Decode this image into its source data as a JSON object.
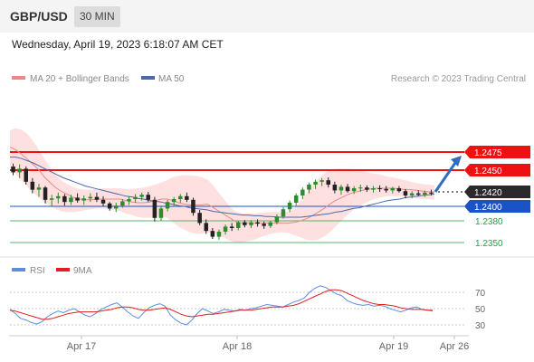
{
  "header": {
    "pair": "GBP/USD",
    "timeframe": "30 MIN"
  },
  "timestamp": "Wednesday, April 19, 2023 6:18:07 AM CET",
  "legend": {
    "ma20": "MA 20 + Bollinger Bands",
    "ma50": "MA 50",
    "credit": "Research © 2023 Trading Central",
    "rsi": "RSI",
    "rsi_ma": "9MA"
  },
  "colors": {
    "resistance": "#ee1111",
    "support": "#1a52c8",
    "target": "#22a33a",
    "bollinger": "#ffd6d6",
    "ma20": "#ee8888",
    "ma50": "#4a6aa8",
    "candle_up": "#2e8b2e",
    "candle_down": "#222222",
    "rsi_line": "#5b8de0",
    "rsi_ma_line": "#e02020",
    "forecast_arrow": "#2f6dc0"
  },
  "chart_data": [
    {
      "type": "line",
      "title": "GBP/USD 30 MIN",
      "x_labels": [
        "Apr 17",
        "Apr 18",
        "Apr 19",
        "Apr 26"
      ],
      "ylim": [
        1.234,
        1.251
      ],
      "y_range_from_lines": true,
      "current_price": 1.242,
      "levels": [
        {
          "label": "1.2475",
          "value": 1.2475,
          "kind": "resistance",
          "style": "thick-line"
        },
        {
          "label": "1.2450",
          "value": 1.245,
          "kind": "resistance",
          "style": "thick-line"
        },
        {
          "label": "1.2420",
          "value": 1.242,
          "kind": "current",
          "style": "dotted"
        },
        {
          "label": "1.2400",
          "value": 1.24,
          "kind": "support",
          "style": "thin-line"
        },
        {
          "label": "1.2380",
          "value": 1.238,
          "kind": "target",
          "style": "thin-line"
        },
        {
          "label": "1.2350",
          "value": 1.235,
          "kind": "target",
          "style": "thin-line"
        }
      ],
      "series": [
        {
          "name": "Price",
          "values": [
            1.2455,
            1.245,
            1.2452,
            1.244,
            1.243,
            1.2432,
            1.2425,
            1.2415,
            1.2408,
            1.241,
            1.2412,
            1.2405,
            1.2408,
            1.241,
            1.2412,
            1.2412,
            1.2413,
            1.2412,
            1.2408,
            1.2405,
            1.2402,
            1.2405,
            1.2408,
            1.241,
            1.2415,
            1.2418,
            1.2415,
            1.2408,
            1.2385,
            1.2398,
            1.2405,
            1.241,
            1.2414,
            1.2418,
            1.2413,
            1.2395,
            1.238,
            1.2368,
            1.2362,
            1.2358,
            1.2368,
            1.2374,
            1.2372,
            1.2378,
            1.2376,
            1.2377,
            1.2378,
            1.2376,
            1.2373,
            1.2376,
            1.2385,
            1.2395,
            1.2405,
            1.2415,
            1.2422,
            1.2428,
            1.2432,
            1.2435,
            1.2432,
            1.2428,
            1.2428,
            1.2422,
            1.242,
            1.2422,
            1.2425,
            1.2424,
            1.2423,
            1.2422,
            1.2423,
            1.2424,
            1.2421,
            1.2415,
            1.2418,
            1.2418
          ]
        },
        {
          "name": "MA 20",
          "values": [
            1.2482,
            1.2478,
            1.2472,
            1.2465,
            1.2458,
            1.245,
            1.244,
            1.2432,
            1.2425,
            1.242,
            1.2416,
            1.2412,
            1.241,
            1.2409,
            1.2409,
            1.241,
            1.241,
            1.241,
            1.241,
            1.241,
            1.2408,
            1.2406,
            1.2405,
            1.2405,
            1.2406,
            1.2408,
            1.241,
            1.241,
            1.2408,
            1.2405,
            1.2403,
            1.2402,
            1.2402,
            1.2402,
            1.2403,
            1.2398,
            1.2393,
            1.2388,
            1.2383,
            1.2378,
            1.2377,
            1.2377,
            1.2377,
            1.2377,
            1.2377,
            1.2377,
            1.2377,
            1.2377,
            1.2377,
            1.2378,
            1.238,
            1.2383,
            1.2387,
            1.2392,
            1.2397,
            1.2403,
            1.2408,
            1.2412,
            1.2416,
            1.2419,
            1.2421,
            1.2423,
            1.2424,
            1.2425,
            1.2425,
            1.2425,
            1.2425,
            1.2424,
            1.2423,
            1.2423,
            1.2422,
            1.2421,
            1.242,
            1.242
          ]
        },
        {
          "name": "MA 50",
          "values": [
            1.2468,
            1.2468,
            1.2466,
            1.2463,
            1.246,
            1.2456,
            1.2452,
            1.2448,
            1.2444,
            1.244,
            1.2437,
            1.2434,
            1.2431,
            1.2428,
            1.2426,
            1.2424,
            1.2422,
            1.242,
            1.2418,
            1.2416,
            1.2414,
            1.2413,
            1.2411,
            1.241,
            1.2408,
            1.2407,
            1.2406,
            1.2404,
            1.2403,
            1.2401,
            1.24,
            1.2398,
            1.2397,
            1.2396,
            1.2395,
            1.2393,
            1.2392,
            1.2391,
            1.239,
            1.2389,
            1.2388,
            1.2388,
            1.2387,
            1.2387,
            1.2386,
            1.2386,
            1.2385,
            1.2385,
            1.2385,
            1.2385,
            1.2385,
            1.2386,
            1.2387,
            1.2388,
            1.2389,
            1.239,
            1.2392,
            1.2393,
            1.2395,
            1.2397,
            1.2398,
            1.24,
            1.2402,
            1.2404,
            1.2406,
            1.2408,
            1.2409,
            1.241,
            1.2412,
            1.2413,
            1.2414,
            1.2415,
            1.2416,
            1.2417
          ]
        },
        {
          "name": "Bollinger Upper",
          "values": [
            1.2505,
            1.2508,
            1.2506,
            1.25,
            1.249,
            1.2478,
            1.2465,
            1.2452,
            1.2442,
            1.2435,
            1.243,
            1.2426,
            1.2424,
            1.2423,
            1.2423,
            1.2424,
            1.2425,
            1.2425,
            1.2425,
            1.2425,
            1.2424,
            1.2424,
            1.2425,
            1.2426,
            1.2428,
            1.243,
            1.2433,
            1.2436,
            1.244,
            1.2442,
            1.2443,
            1.2443,
            1.2442,
            1.244,
            1.2437,
            1.2428,
            1.2418,
            1.2408,
            1.2398,
            1.2392,
            1.239,
            1.239,
            1.239,
            1.2391,
            1.2392,
            1.2392,
            1.2392,
            1.2392,
            1.2393,
            1.2398,
            1.2408,
            1.2418,
            1.2428,
            1.2438,
            1.2445,
            1.245,
            1.2452,
            1.2452,
            1.2452,
            1.2451,
            1.245,
            1.2448,
            1.2446,
            1.2445,
            1.2443,
            1.2441,
            1.244,
            1.2438,
            1.2436,
            1.2434,
            1.2432,
            1.2431,
            1.243,
            1.2429
          ]
        },
        {
          "name": "Bollinger Lower",
          "values": [
            1.2452,
            1.2445,
            1.2436,
            1.2427,
            1.2419,
            1.2412,
            1.2405,
            1.24,
            1.2396,
            1.2393,
            1.2392,
            1.2392,
            1.2393,
            1.2395,
            1.2396,
            1.2397,
            1.2397,
            1.2396,
            1.2395,
            1.2393,
            1.239,
            1.2388,
            1.2385,
            1.2384,
            1.2384,
            1.2385,
            1.2386,
            1.2384,
            1.2378,
            1.2372,
            1.2368,
            1.2364,
            1.2362,
            1.2362,
            1.2364,
            1.2363,
            1.236,
            1.2356,
            1.2352,
            1.235,
            1.235,
            1.2352,
            1.2354,
            1.2357,
            1.236,
            1.2362,
            1.2364,
            1.2364,
            1.2363,
            1.236,
            1.2357,
            1.2354,
            1.2353,
            1.2354,
            1.2358,
            1.2364,
            1.2372,
            1.238,
            1.2388,
            1.2395,
            1.24,
            1.2404,
            1.2408,
            1.2411,
            1.2413,
            1.2414,
            1.2414,
            1.2414,
            1.2413,
            1.2412,
            1.2411,
            1.241,
            1.241,
            1.2409
          ]
        }
      ],
      "candles": [
        [
          1.2455,
          1.2459,
          1.2443,
          1.2447
        ],
        [
          1.2447,
          1.2458,
          1.2439,
          1.2452
        ],
        [
          1.2452,
          1.2455,
          1.243,
          1.2434
        ],
        [
          1.2434,
          1.2439,
          1.2418,
          1.2423
        ],
        [
          1.2423,
          1.2431,
          1.2413,
          1.2426
        ],
        [
          1.2426,
          1.2428,
          1.2404,
          1.2409
        ],
        [
          1.2409,
          1.2416,
          1.24,
          1.2411
        ],
        [
          1.2411,
          1.2419,
          1.2404,
          1.2414
        ],
        [
          1.2414,
          1.2417,
          1.2401,
          1.2406
        ],
        [
          1.2406,
          1.2416,
          1.2402,
          1.2412
        ],
        [
          1.2412,
          1.2418,
          1.2405,
          1.2408
        ],
        [
          1.2408,
          1.2415,
          1.2402,
          1.2411
        ],
        [
          1.2411,
          1.2418,
          1.2406,
          1.2413
        ],
        [
          1.2413,
          1.2419,
          1.2406,
          1.2409
        ],
        [
          1.2409,
          1.2414,
          1.24,
          1.2404
        ],
        [
          1.2404,
          1.2406,
          1.2394,
          1.2397
        ],
        [
          1.2397,
          1.2405,
          1.2392,
          1.2401
        ],
        [
          1.2401,
          1.241,
          1.2398,
          1.2407
        ],
        [
          1.2407,
          1.2414,
          1.2402,
          1.241
        ],
        [
          1.241,
          1.2417,
          1.2405,
          1.2413
        ],
        [
          1.2413,
          1.2419,
          1.2408,
          1.2416
        ],
        [
          1.2416,
          1.242,
          1.2406,
          1.2409
        ],
        [
          1.2409,
          1.2413,
          1.2379,
          1.2384
        ],
        [
          1.2384,
          1.2401,
          1.238,
          1.2397
        ],
        [
          1.2397,
          1.2409,
          1.2393,
          1.2406
        ],
        [
          1.2406,
          1.2413,
          1.2401,
          1.241
        ],
        [
          1.241,
          1.2417,
          1.2405,
          1.2414
        ],
        [
          1.2414,
          1.2419,
          1.2406,
          1.2409
        ],
        [
          1.2409,
          1.2412,
          1.2387,
          1.2391
        ],
        [
          1.2391,
          1.2395,
          1.2374,
          1.2377
        ],
        [
          1.2377,
          1.2382,
          1.2362,
          1.2366
        ],
        [
          1.2366,
          1.237,
          1.2355,
          1.2358
        ],
        [
          1.2358,
          1.2368,
          1.2354,
          1.2365
        ],
        [
          1.2365,
          1.2375,
          1.2361,
          1.2372
        ],
        [
          1.2372,
          1.2377,
          1.2366,
          1.237
        ],
        [
          1.237,
          1.238,
          1.2367,
          1.2378
        ],
        [
          1.2378,
          1.2381,
          1.2371,
          1.2374
        ],
        [
          1.2374,
          1.2381,
          1.237,
          1.2378
        ],
        [
          1.2378,
          1.2382,
          1.2372,
          1.2376
        ],
        [
          1.2376,
          1.2379,
          1.2369,
          1.2373
        ],
        [
          1.2373,
          1.238,
          1.237,
          1.2378
        ],
        [
          1.2378,
          1.2389,
          1.2375,
          1.2386
        ],
        [
          1.2386,
          1.2399,
          1.2383,
          1.2396
        ],
        [
          1.2396,
          1.2408,
          1.2392,
          1.2405
        ],
        [
          1.2405,
          1.2418,
          1.2401,
          1.2415
        ],
        [
          1.2415,
          1.2426,
          1.241,
          1.2423
        ],
        [
          1.2423,
          1.2433,
          1.2418,
          1.243
        ],
        [
          1.243,
          1.2437,
          1.2424,
          1.2434
        ],
        [
          1.2434,
          1.2439,
          1.2428,
          1.2436
        ],
        [
          1.2436,
          1.244,
          1.2426,
          1.243
        ],
        [
          1.243,
          1.2434,
          1.2418,
          1.2422
        ],
        [
          1.2422,
          1.243,
          1.2416,
          1.2427
        ],
        [
          1.2427,
          1.2431,
          1.2419,
          1.2421
        ],
        [
          1.2421,
          1.2428,
          1.2417,
          1.2425
        ],
        [
          1.2425,
          1.243,
          1.242,
          1.2426
        ],
        [
          1.2426,
          1.2429,
          1.242,
          1.2423
        ],
        [
          1.2423,
          1.2428,
          1.2419,
          1.2425
        ],
        [
          1.2425,
          1.2429,
          1.242,
          1.2424
        ],
        [
          1.2424,
          1.2428,
          1.2419,
          1.2422
        ],
        [
          1.2422,
          1.2427,
          1.2418,
          1.2425
        ],
        [
          1.2425,
          1.2428,
          1.2419,
          1.2421
        ],
        [
          1.2421,
          1.2424,
          1.2411,
          1.2415
        ],
        [
          1.2415,
          1.2421,
          1.2411,
          1.2418
        ],
        [
          1.2418,
          1.2422,
          1.2414,
          1.2416
        ],
        [
          1.2416,
          1.2422,
          1.2413,
          1.2419
        ],
        [
          1.2419,
          1.2423,
          1.2415,
          1.2418
        ]
      ],
      "forecast_arrow": {
        "from": 1.242,
        "to": 1.2475
      }
    },
    {
      "type": "line",
      "title": "RSI",
      "yticks": [
        70,
        50,
        30
      ],
      "ylim": [
        20,
        80
      ],
      "series": [
        {
          "name": "RSI",
          "values": [
            49,
            44,
            38,
            36,
            33,
            31,
            34,
            40,
            44,
            47,
            45,
            48,
            50,
            46,
            42,
            40,
            44,
            49,
            52,
            55,
            57,
            52,
            46,
            41,
            38,
            45,
            51,
            54,
            56,
            53,
            42,
            36,
            32,
            30,
            36,
            44,
            50,
            47,
            44,
            46,
            49,
            48,
            47,
            49,
            48,
            50,
            51,
            53,
            55,
            54,
            53,
            52,
            55,
            58,
            60,
            63,
            70,
            75,
            78,
            76,
            72,
            68,
            66,
            60,
            57,
            55,
            54,
            55,
            53,
            54,
            53,
            50,
            48,
            46,
            48,
            51,
            52,
            49,
            48,
            47
          ]
        },
        {
          "name": "9MA",
          "values": [
            48,
            47,
            45,
            43,
            41,
            39,
            37,
            37,
            38,
            40,
            42,
            44,
            45,
            46,
            46,
            46,
            46,
            47,
            48,
            49,
            51,
            52,
            52,
            51,
            49,
            48,
            48,
            49,
            50,
            51,
            49,
            46,
            43,
            41,
            40,
            41,
            42,
            43,
            43,
            44,
            45,
            46,
            47,
            48,
            48,
            48,
            49,
            50,
            51,
            52,
            52,
            52,
            53,
            54,
            56,
            59,
            62,
            65,
            68,
            71,
            73,
            73,
            72,
            69,
            66,
            63,
            60,
            58,
            56,
            55,
            55,
            54,
            53,
            51,
            50,
            49,
            49,
            49,
            48,
            48
          ]
        }
      ]
    }
  ]
}
